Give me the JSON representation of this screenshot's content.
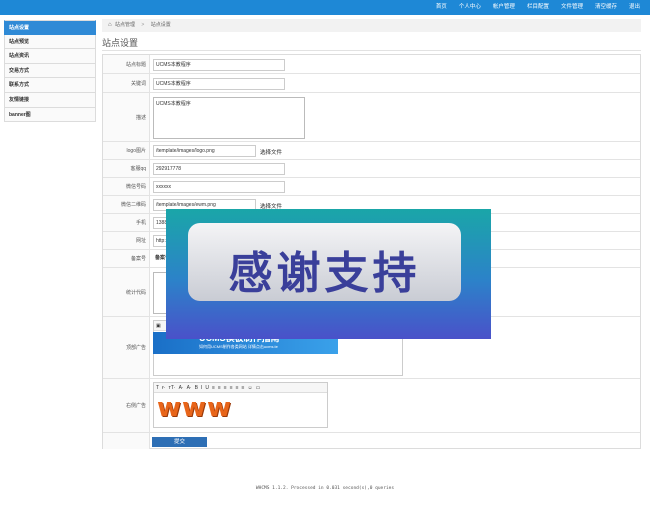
{
  "topnav": [
    "首页",
    "个人中心",
    "帐户管理",
    "栏目配置",
    "文件管理",
    "清空缓存",
    "退出"
  ],
  "sidebar": [
    "站点设置",
    "站点预览",
    "站点资讯",
    "交易方式",
    "联系方式",
    "友情链接",
    "banner图"
  ],
  "breadcrumb": {
    "home": "站点管理",
    "current": "站点设置"
  },
  "page_title": "站点设置",
  "fields": {
    "site_title": {
      "label": "站点标题",
      "value": "UCMS本教程序"
    },
    "keywords": {
      "label": "关键词",
      "value": "UCMS本教程序"
    },
    "description": {
      "label": "描述",
      "value": "UCMS本教程序"
    },
    "logo": {
      "label": "logo图片",
      "value": "/template/images/logo.png",
      "button": "选择文件"
    },
    "qq": {
      "label": "客服qq",
      "value": "292917778"
    },
    "wechat": {
      "label": "微信号码",
      "value": "xxxxxx"
    },
    "qrcode": {
      "label": "微信二维码",
      "value": "/template/images/ewm.png",
      "button": "选择文件"
    },
    "phone": {
      "label": "手机",
      "value": "1388"
    },
    "url": {
      "label": "网址",
      "value": "http://u"
    },
    "icp": {
      "label": "备案号",
      "value": "备案号"
    },
    "stats": {
      "label": "统计代码"
    },
    "top_ad": {
      "label": "顶部广告",
      "banner_title": "UCMS模板制作指南",
      "banner_sub": "如何用UCMS制作各类网站 详情点击ucms.te"
    },
    "bottom_ad": {
      "label": "右侧广告",
      "image_text": "www"
    }
  },
  "editor_tools": [
    "T",
    "ғ·",
    "тT·",
    "A·",
    "A·",
    "B",
    "I",
    "U",
    "≡",
    "≡",
    "≡",
    "≡",
    "≡",
    "≡",
    "☺",
    "▭"
  ],
  "submit": "提交",
  "footer": "WHCMS 1.1.2. Processed in 0.031 second(s),0 queries",
  "overlay_text": "感谢支持",
  "colors": {
    "topbar": "#1e88d6",
    "active": "#2f8ad6",
    "submit": "#2e6fb5"
  }
}
